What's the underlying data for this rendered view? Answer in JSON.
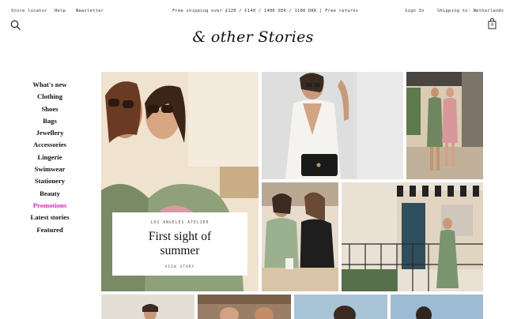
{
  "utility_bar": {
    "store_locator": "Store locator",
    "help": "Help",
    "newsletter": "Newsletter",
    "shipping_notice": "Free shipping over £120 / €140 / 1400 SEK / 1100 DKK | Free returns",
    "sign_in": "Sign In",
    "shipping_to": "Shipping to: Netherlands"
  },
  "header": {
    "logo": "& other Stories",
    "search_icon": "search-icon",
    "bag_icon": "shopping-bag-icon",
    "bag_count": "0"
  },
  "nav": {
    "items": [
      {
        "label": "What's new"
      },
      {
        "label": "Clothing"
      },
      {
        "label": "Shoes"
      },
      {
        "label": "Bags"
      },
      {
        "label": "Jewellery"
      },
      {
        "label": "Accessories"
      },
      {
        "label": "Lingerie"
      },
      {
        "label": "Swimwear"
      },
      {
        "label": "Stationery"
      },
      {
        "label": "Beauty"
      },
      {
        "label": "Promotions"
      },
      {
        "label": "Latest stories"
      },
      {
        "label": "Featured"
      }
    ],
    "promo_color": "#e628c4"
  },
  "feature": {
    "kicker": "LOS ANGELES ATELIER",
    "headline_line1": "First sight of",
    "headline_line2": "summer",
    "cta": "VIEW STORY"
  }
}
